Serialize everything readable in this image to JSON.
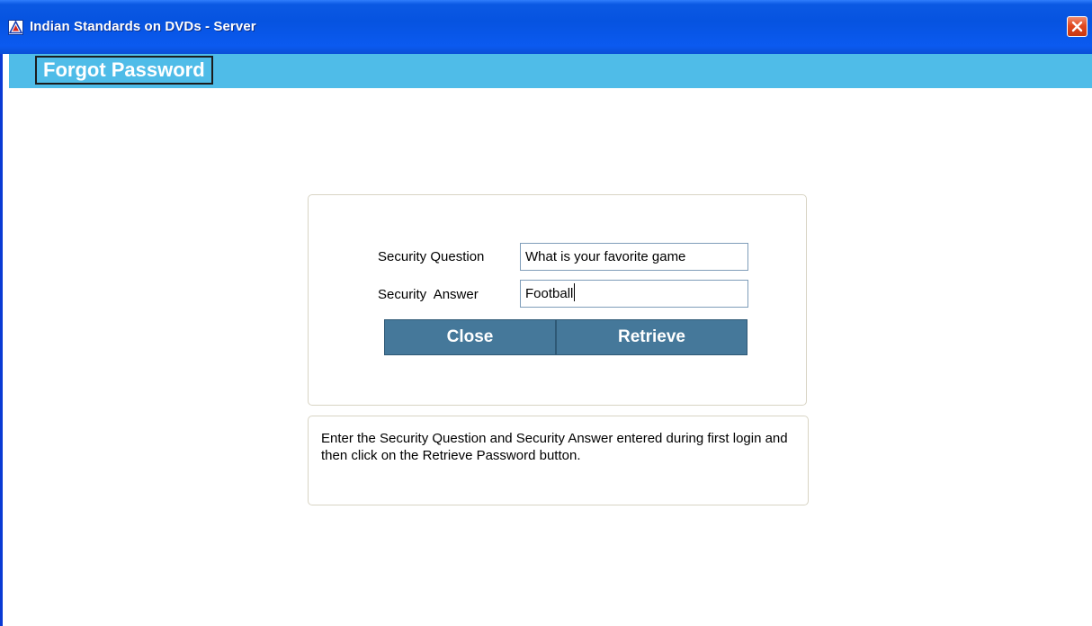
{
  "window": {
    "title": "Indian Standards on DVDs - Server",
    "icon": "bis-logo-icon",
    "close_icon": "close-icon"
  },
  "header": {
    "title": "Forgot Password"
  },
  "form": {
    "question_label": "Security Question",
    "question_value": "What is your favorite game",
    "answer_label": "Security  Answer",
    "answer_value": "Football",
    "close_label": "Close",
    "retrieve_label": "Retrieve"
  },
  "help": {
    "text": "Enter the Security Question and Security Answer entered during first login and then click on the Retrieve Password button."
  },
  "colors": {
    "titlebar": "#0653e0",
    "header_band": "#4fbce8",
    "button": "#45789a"
  }
}
